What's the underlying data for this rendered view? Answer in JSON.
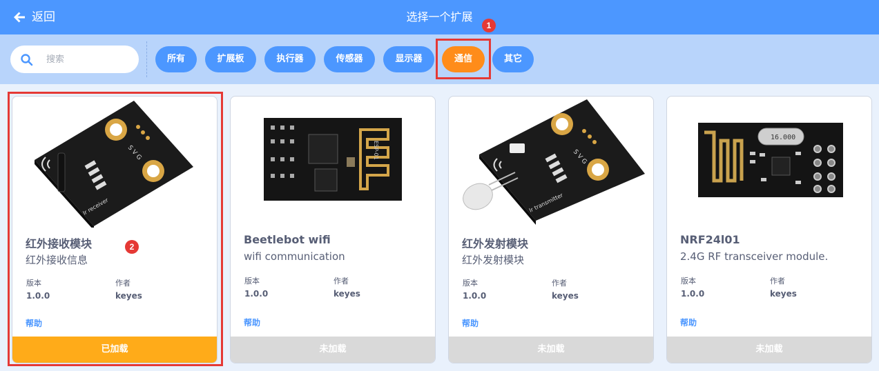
{
  "header": {
    "back_label": "返回",
    "title": "选择一个扩展",
    "badge": "1"
  },
  "search": {
    "placeholder": "搜索"
  },
  "filters": [
    {
      "label": "所有",
      "active": false
    },
    {
      "label": "扩展板",
      "active": false
    },
    {
      "label": "执行器",
      "active": false
    },
    {
      "label": "传感器",
      "active": false
    },
    {
      "label": "显示器",
      "active": false
    },
    {
      "label": "通信",
      "active": true
    },
    {
      "label": "其它",
      "active": false
    }
  ],
  "meta_labels": {
    "version": "版本",
    "author": "作者",
    "help": "帮助"
  },
  "cards": [
    {
      "name": "红外接收模块",
      "description": "红外接收信息",
      "version": "1.0.0",
      "author": "keyes",
      "status": "已加载",
      "loaded": true,
      "badge": "2",
      "image": "ir-receiver-module",
      "board_text": "Ir receiver"
    },
    {
      "name": "Beetlebot wifi",
      "description": "wifi communication",
      "version": "1.0.0",
      "author": "keyes",
      "status": "未加载",
      "loaded": false,
      "image": "esp-01-wifi-module",
      "board_text": "ESP-01"
    },
    {
      "name": "红外发射模块",
      "description": "红外发射模块",
      "version": "1.0.0",
      "author": "keyes",
      "status": "未加载",
      "loaded": false,
      "image": "ir-transmitter-module",
      "board_text": "Ir transmitter"
    },
    {
      "name": "NRF24l01",
      "description": "2.4G RF transceiver module.",
      "version": "1.0.0",
      "author": "keyes",
      "status": "未加载",
      "loaded": false,
      "image": "nrf24l01-module",
      "board_text": "16.000"
    }
  ],
  "colors": {
    "header": "#4c97ff",
    "filter_bar": "#b8d4fb",
    "chip": "#4c97ff",
    "chip_active": "#ff8c1a",
    "loaded": "#ffab19",
    "not_loaded": "#d9d9d9",
    "highlight": "#e53935"
  }
}
